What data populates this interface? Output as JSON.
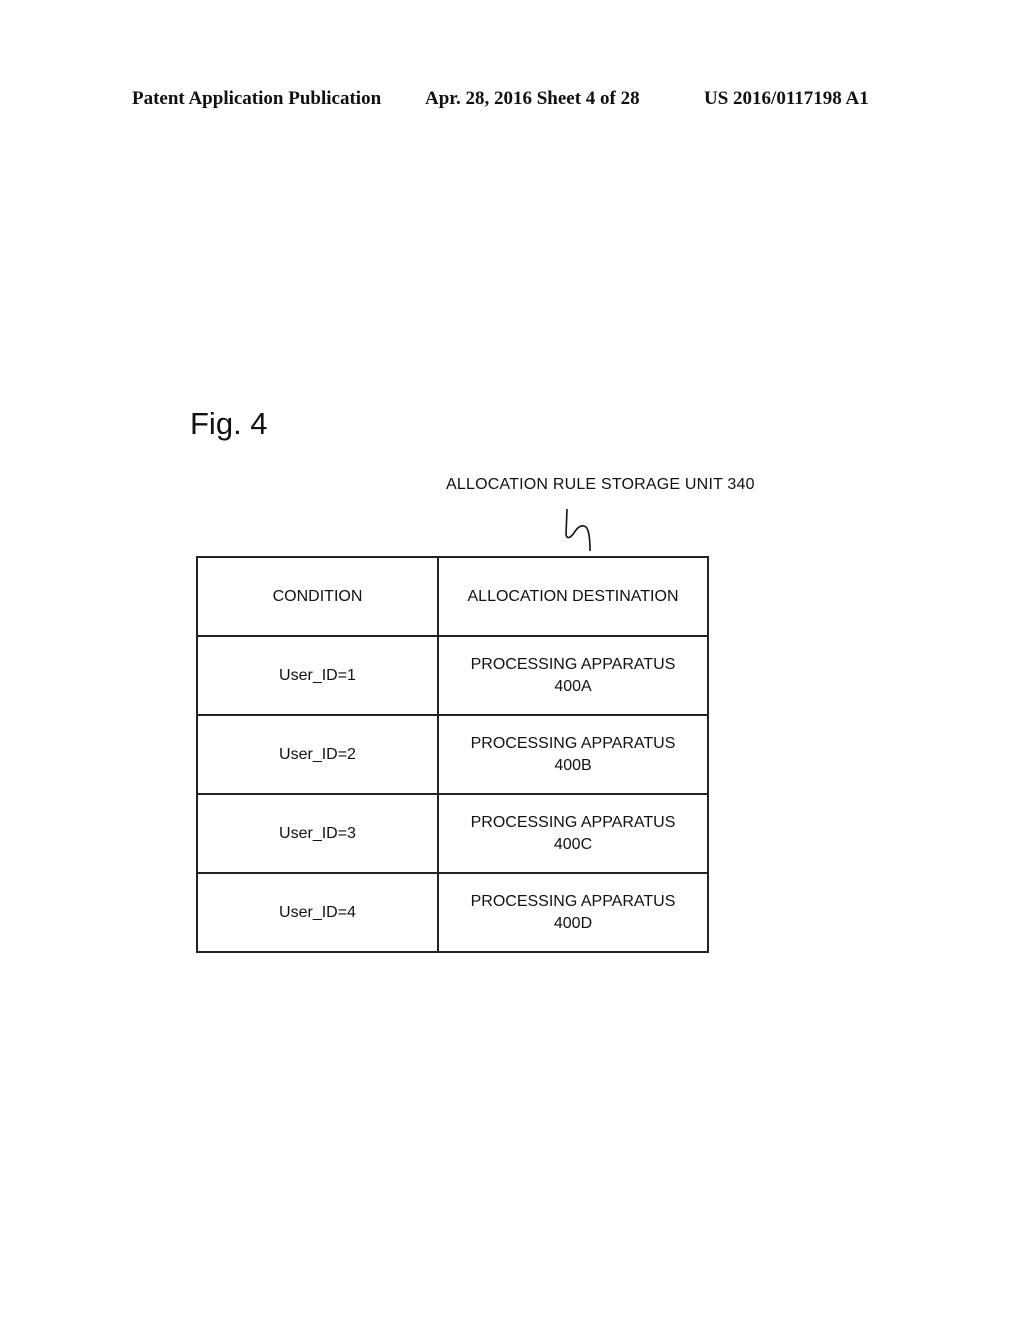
{
  "header": {
    "publication": "Patent Application Publication",
    "date_sheet": "Apr. 28, 2016  Sheet 4 of 28",
    "patent_number": "US 2016/0117198 A1"
  },
  "figure": {
    "title": "Fig. 4",
    "unit_label": "ALLOCATION RULE STORAGE UNIT 340",
    "table": {
      "headers": [
        "CONDITION",
        "ALLOCATION DESTINATION"
      ],
      "rows": [
        {
          "condition": "User_ID=1",
          "destination_line1": "PROCESSING APPARATUS",
          "destination_line2": "400A"
        },
        {
          "condition": "User_ID=2",
          "destination_line1": "PROCESSING APPARATUS",
          "destination_line2": "400B"
        },
        {
          "condition": "User_ID=3",
          "destination_line1": "PROCESSING APPARATUS",
          "destination_line2": "400C"
        },
        {
          "condition": "User_ID=4",
          "destination_line1": "PROCESSING APPARATUS",
          "destination_line2": "400D"
        }
      ]
    }
  }
}
